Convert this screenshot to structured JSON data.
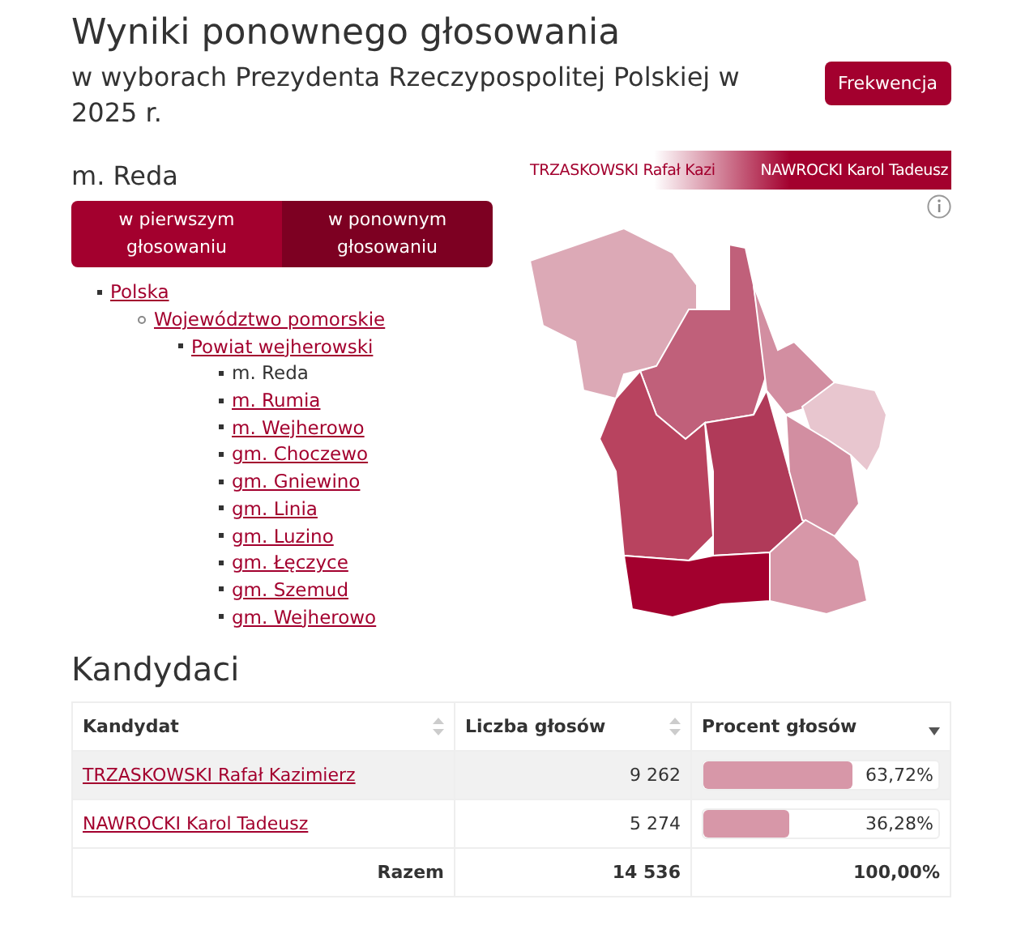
{
  "header": {
    "title": "Wyniki ponownego głosowania",
    "subtitle": "w wyborach Prezydenta Rzeczypospolitej Polskiej w 2025 r.",
    "button": "Frekwencja"
  },
  "place": "m. Reda",
  "tabs": [
    {
      "label": "w pierwszym głosowaniu",
      "selected": false
    },
    {
      "label": "w ponownym głosowaniu",
      "selected": true
    }
  ],
  "tree": [
    {
      "label": "Polska",
      "selected": false,
      "children": [
        {
          "label": "Województwo pomorskie",
          "selected": false,
          "children": [
            {
              "label": "Powiat wejherowski",
              "selected": false,
              "children": [
                {
                  "label": "m. Reda",
                  "selected": true
                },
                {
                  "label": "m. Rumia",
                  "selected": false
                },
                {
                  "label": "m. Wejherowo",
                  "selected": false
                },
                {
                  "label": "gm. Choczewo",
                  "selected": false
                },
                {
                  "label": "gm. Gniewino",
                  "selected": false
                },
                {
                  "label": "gm. Linia",
                  "selected": false
                },
                {
                  "label": "gm. Luzino",
                  "selected": false
                },
                {
                  "label": "gm. Łęczyce",
                  "selected": false
                },
                {
                  "label": "gm. Szemud",
                  "selected": false
                },
                {
                  "label": "gm. Wejherowo",
                  "selected": false
                }
              ]
            }
          ]
        }
      ]
    }
  ],
  "legend": {
    "left": "TRZASKOWSKI Rafał Kazi",
    "right": "NAWROCKI Karol Tadeusz"
  },
  "section_title": "Kandydaci",
  "table": {
    "columns": [
      {
        "label": "Kandydat",
        "sorted": false
      },
      {
        "label": "Liczba głosów",
        "sorted": false
      },
      {
        "label": "Procent głosów",
        "sorted": true
      }
    ],
    "rows": [
      {
        "name": "TRZASKOWSKI Rafał Kazimierz",
        "votes": "9 262",
        "percent": "63,72%",
        "level": 0.6372,
        "selected": true
      },
      {
        "name": "NAWROCKI Karol Tadeusz",
        "votes": "5 274",
        "percent": "36,28%",
        "level": 0.3628,
        "selected": false
      }
    ],
    "total": {
      "label": "Razem",
      "votes": "14 536",
      "percent": "100,00%"
    }
  }
}
